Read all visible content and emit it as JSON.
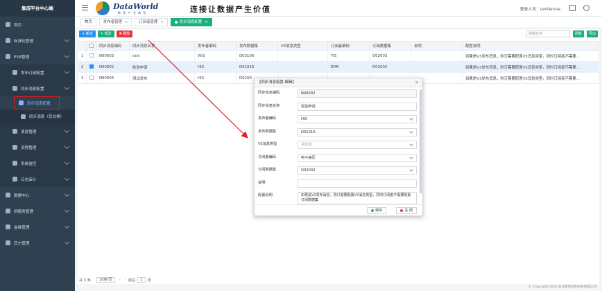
{
  "sidebar": {
    "brand": "集成平台中心端",
    "items": [
      {
        "label": "首页"
      },
      {
        "label": "标准化管理"
      },
      {
        "label": "ESB管理"
      },
      {
        "label": "发布订阅配置"
      },
      {
        "label": "同步消息配置"
      },
      {
        "label": "同步消息配置"
      },
      {
        "label": "同步消息（仅交换）"
      },
      {
        "label": "消息管理"
      },
      {
        "label": "流程管理"
      },
      {
        "label": "系统监控"
      },
      {
        "label": "日志审计"
      },
      {
        "label": "数据中心"
      },
      {
        "label": "侧服务管理"
      },
      {
        "label": "监维管理"
      },
      {
        "label": "其它管理"
      }
    ]
  },
  "header": {
    "logo_text": "DataWorld",
    "logo_sub": "数 智 产 业 典 范",
    "slogan": "连接让数据产生价值",
    "user": "登录人员：centervue"
  },
  "tabs": [
    {
      "label": "首页"
    },
    {
      "label": "发布者管理"
    },
    {
      "label": "订阅者管理"
    },
    {
      "label": "同步消息配置"
    }
  ],
  "toolbar": {
    "add": "+ 新增",
    "edit": "✎ 修改",
    "delete": "✖ 删除",
    "search_placeholder": "模糊名称",
    "refresh": "刷新",
    "export": "导出"
  },
  "table": {
    "headers": [
      "",
      "同步消息编码",
      "同步消息名称",
      "发布者编码",
      "发布数据集",
      "V3消息类型",
      "订阅者编码",
      "订阅数据集",
      "说明",
      "配置说明"
    ],
    "rows": [
      {
        "idx": "1",
        "checked": false,
        "code": "N00003",
        "name": "test",
        "pub": "WIS",
        "pubset": "D03106",
        "v3": "",
        "sub": "YIS",
        "subset": "D02003",
        "desc": "",
        "config": "如果是V3发布消息，则订需要配置V3消息类型，同时订阅者不需要..."
      },
      {
        "idx": "2",
        "checked": true,
        "code": "N00002",
        "name": "检验申请",
        "pub": "HIS",
        "pubset": "D01016",
        "v3": "",
        "sub": "EMR",
        "subset": "D02002",
        "desc": "",
        "config": "如果是V3发布消息，则订需要配置V3消息类型，同时订阅者不需要..."
      },
      {
        "idx": "3",
        "checked": false,
        "code": "N00004",
        "name": "测试发布",
        "pub": "HIS",
        "pubset": "D0200",
        "v3": "",
        "sub": "",
        "subset": "",
        "desc": "",
        "config": "如果是V3发布消息，则订需要配置V3消息类型，同时订阅者不需要..."
      }
    ]
  },
  "modal": {
    "title": "【同步消息配置:编辑】",
    "fields": [
      {
        "label": "同步消息编码",
        "value": "N00002",
        "placeholder": false,
        "dropdown": false
      },
      {
        "label": "同步消息名称",
        "value": "检验申请",
        "placeholder": false,
        "dropdown": false
      },
      {
        "label": "发布者编码",
        "value": "HIS",
        "placeholder": false,
        "dropdown": true
      },
      {
        "label": "发布数据集",
        "value": "D01016",
        "placeholder": false,
        "dropdown": true
      },
      {
        "label": "V3消息类型",
        "value": "请选择",
        "placeholder": true,
        "dropdown": true
      },
      {
        "label": "订阅者编码",
        "value": "电子病历",
        "placeholder": false,
        "dropdown": true
      },
      {
        "label": "订阅数据集",
        "value": "D02002",
        "placeholder": false,
        "dropdown": true
      },
      {
        "label": "说明",
        "value": "",
        "placeholder": false,
        "dropdown": false
      }
    ],
    "config_label": "配置说明",
    "config_value": "如果是V3发布消息，则订需要配置V3消息类型，同时订阅者不需要配置订阅数据集",
    "save": "保存",
    "close": "关 闭"
  },
  "pager": {
    "total": "共 3 条",
    "page_size": "20条/页",
    "goto": "前往",
    "page": "1",
    "unit": "页"
  },
  "copyright": "© Copyright 2016 长沙摩尼软件科技有限公司",
  "colors": {
    "sidebar": "#2f4050",
    "accent": "#1cae7e",
    "primary": "#2d8ef0",
    "danger": "#e4393c",
    "highlight": "#e21d1d"
  }
}
